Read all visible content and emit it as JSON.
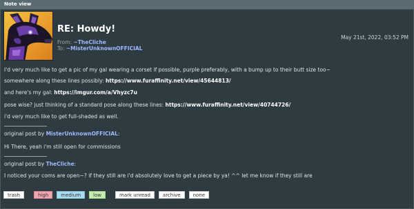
{
  "header": {
    "title": "Note view"
  },
  "note": {
    "subject": "RE: Howdy!",
    "from_label": "From:",
    "from_user": "~TheCliche",
    "to_label": "To:",
    "to_user": "~MisterUnknownOFFICIAL",
    "date": "May 21st, 2022, 03:52 PM"
  },
  "body": {
    "line1": "I'd very much like to get a pic of my gal wearing a corset if possible, purple preferably, with a bump up to their butt size too~",
    "line2_text": "somewhere along these lines possibly: ",
    "line2_link": "https://www.furaffinity.net/view/45644813/",
    "line3_text": "and here's my gal: ",
    "line3_link": "https://imgur.com/a/Vhyzc7u",
    "line4_text": "pose wise? just thinking of a standard pose along these lines: ",
    "line4_link": "https://www.furaffinity.net/view/40744726/",
    "line5": "i'd very much like to get full-shaded as well.",
    "quote1_prefix": "original post by ",
    "quote1_user": "MisterUnknownOFFICIAL",
    "quote1_suffix": ":",
    "quote1_text": "Hi There, yeah i'm still open for commissions",
    "quote2_prefix": "original post by ",
    "quote2_user": "TheCliche",
    "quote2_suffix": ":",
    "quote2_text": "I noticed your coms are open~? if they still are i'd absolutely love to get a piece by ya! ^^ let me know if they still are"
  },
  "actions": {
    "trash": "trash",
    "high": "high",
    "medium": "medium",
    "low": "low",
    "mark_unread": "mark unread",
    "archive": "archive",
    "none": "none"
  }
}
